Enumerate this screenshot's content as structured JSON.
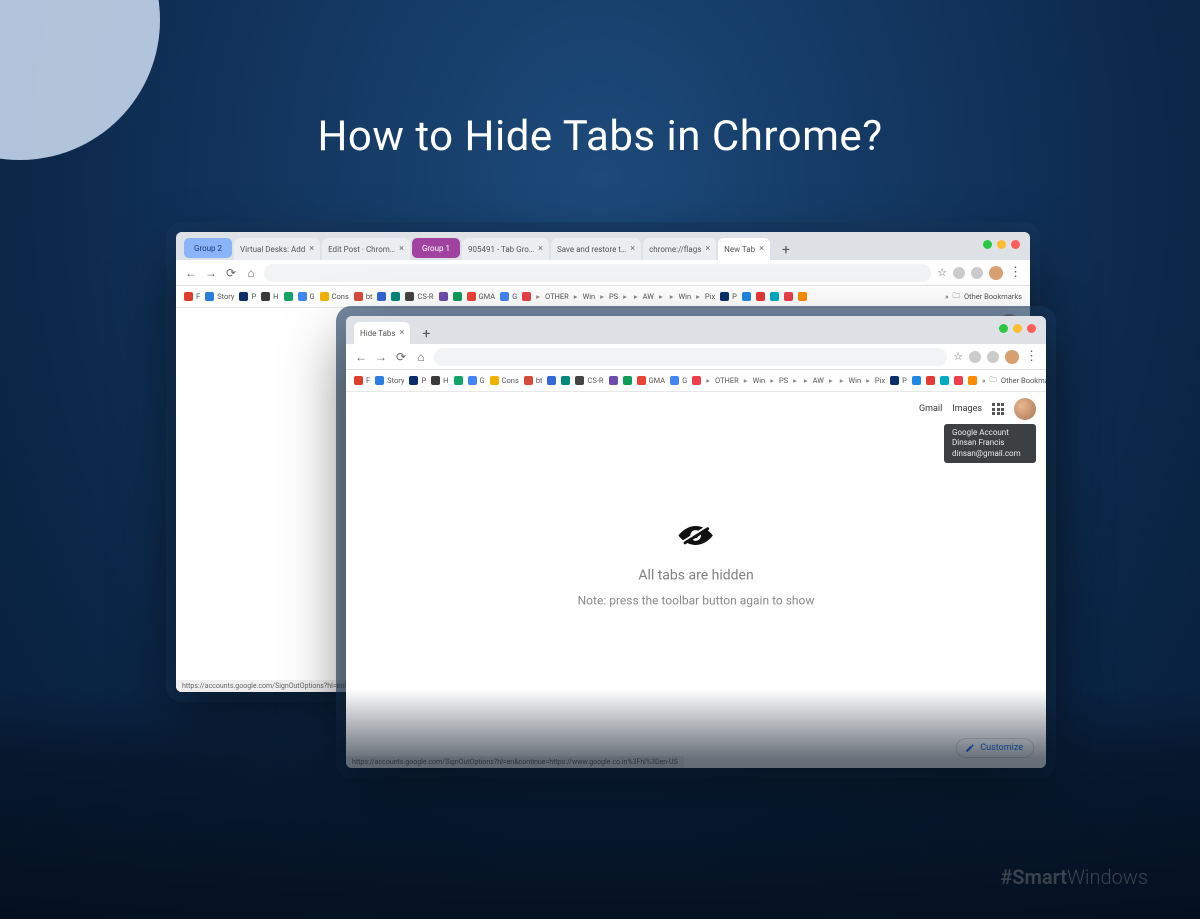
{
  "headline": "How to Hide Tabs in Chrome?",
  "hashtag_bold": "#Smart",
  "hashtag_light": "Windows",
  "back_window": {
    "groups": [
      {
        "label": "Group 2",
        "color": "blue"
      },
      {
        "label": "Group 1",
        "color": "purple"
      }
    ],
    "tabs": [
      {
        "label": "Virtual Desks: Add",
        "closable": true
      },
      {
        "label": "Edit Post · Chrom…",
        "closable": true
      },
      {
        "label": "905491 - Tab Gro…",
        "closable": true
      },
      {
        "label": "Save and restore t…",
        "closable": true
      },
      {
        "label": "chrome://flags",
        "closable": true
      },
      {
        "label": "New Tab",
        "closable": true
      }
    ],
    "ntp_links": [
      "Gmail",
      "Images"
    ],
    "tooltip": "Google Account",
    "status_url": "https://accounts.google.com/SignOutOptions?hl=en&continue=https…"
  },
  "front_window": {
    "tab": {
      "label": "Hide Tabs",
      "closable": true
    },
    "ntp_links": [
      "Gmail",
      "Images"
    ],
    "tooltip_lines": [
      "Google Account",
      "Dinsan Francis",
      "dinsan@gmail.com"
    ],
    "hidden_message": "All tabs are hidden",
    "hidden_note": "Note: press the toolbar button again to show",
    "customize_label": "Customize",
    "status_url": "https://accounts.google.com/SignOutOptions?hl=en&continue=https://www.google.co.in%3Fhl%3Den-US"
  },
  "bookmarks": [
    {
      "label": "F",
      "color": "#e03e2d"
    },
    {
      "label": "Story",
      "color": "#2b7de0"
    },
    {
      "label": "P",
      "color": "#0c2f6b"
    },
    {
      "label": "H",
      "color": "#3a3a3a"
    },
    {
      "label": "",
      "color": "#11a466"
    },
    {
      "label": "G",
      "color": "#4285f4"
    },
    {
      "label": "Cons",
      "color": "#f2b200"
    },
    {
      "label": "bt",
      "color": "#d84b3a"
    },
    {
      "label": "",
      "color": "#3367d6"
    },
    {
      "label": "",
      "color": "#00897b"
    },
    {
      "label": "CS-R",
      "color": "#444"
    },
    {
      "label": "",
      "color": "#6d4caf"
    },
    {
      "label": "",
      "color": "#0f9d58"
    },
    {
      "label": "GMA",
      "color": "#ea4335"
    },
    {
      "label": "G",
      "color": "#4285f4"
    },
    {
      "label": "",
      "color": "#ef3e4a"
    },
    {
      "label": "OTHER",
      "color": "#777",
      "folder": true
    },
    {
      "label": "Win",
      "color": "#777",
      "folder": true
    },
    {
      "label": "PS",
      "color": "#777",
      "folder": true
    },
    {
      "label": "",
      "color": "#777",
      "folder": true
    },
    {
      "label": "AW",
      "color": "#777",
      "folder": true
    },
    {
      "label": "",
      "color": "#777",
      "folder": true
    },
    {
      "label": "Win",
      "color": "#777",
      "folder": true
    },
    {
      "label": "Pix",
      "color": "#777",
      "folder": true
    },
    {
      "label": "P",
      "color": "#0c2f6b"
    },
    {
      "label": "",
      "color": "#1e88e5"
    },
    {
      "label": "",
      "color": "#e53935"
    },
    {
      "label": "",
      "color": "#00acc1"
    },
    {
      "label": "",
      "color": "#ef3e4a"
    },
    {
      "label": "",
      "color": "#fb8c00"
    }
  ],
  "other_bookmarks_label": "Other Bookmarks"
}
